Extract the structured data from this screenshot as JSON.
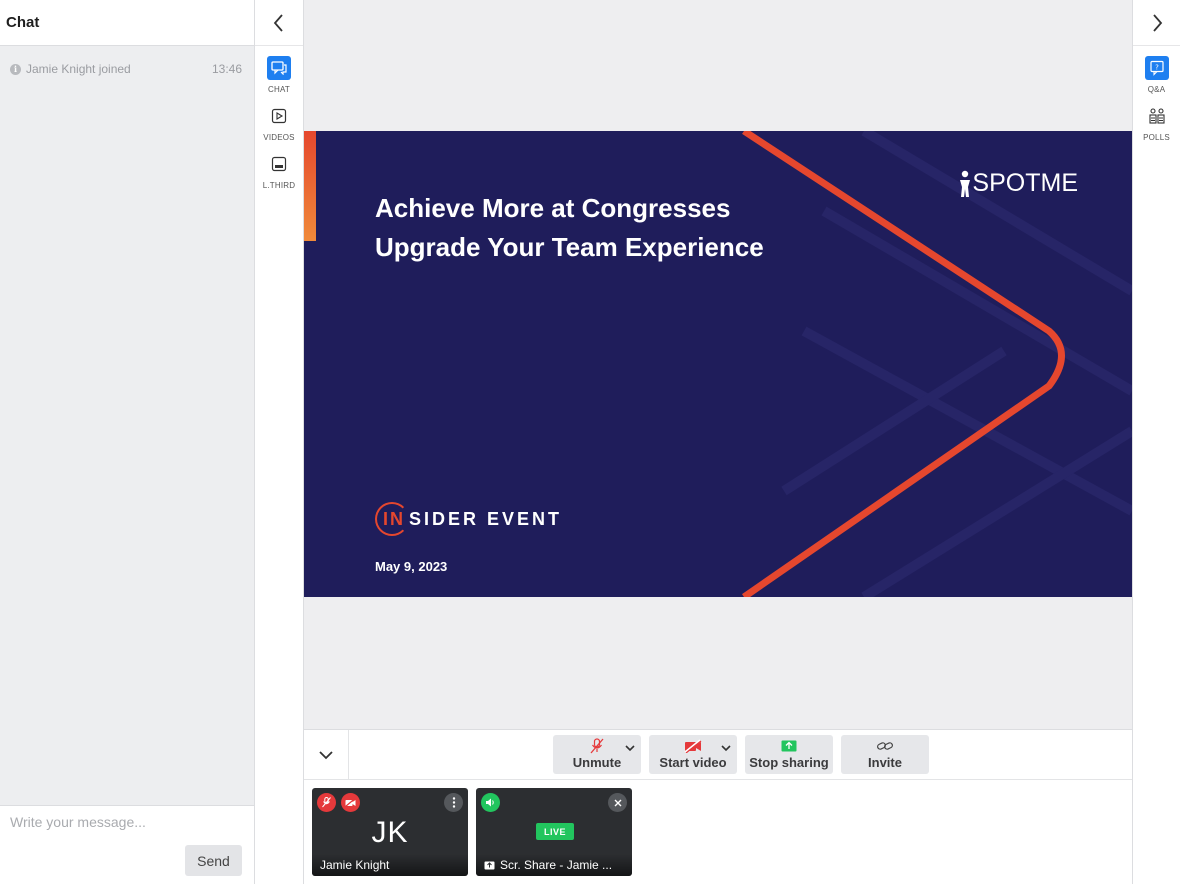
{
  "chat": {
    "title": "Chat",
    "messages": [
      {
        "icon": "info-icon",
        "text": "Jamie Knight joined",
        "time": "13:46"
      }
    ],
    "input_placeholder": "Write your message...",
    "send_label": "Send"
  },
  "left_rail": {
    "items": [
      {
        "label": "CHAT",
        "icon": "chat-icon",
        "active": true
      },
      {
        "label": "VIDEOS",
        "icon": "video-play-icon",
        "active": false
      },
      {
        "label": "L.THIRD",
        "icon": "lower-third-icon",
        "active": false
      }
    ]
  },
  "right_rail": {
    "items": [
      {
        "label": "Q&A",
        "icon": "qa-icon",
        "active": true
      },
      {
        "label": "POLLS",
        "icon": "polls-icon",
        "active": false
      }
    ]
  },
  "slide": {
    "title_line1": "Achieve More at Congresses",
    "title_line2": "Upgrade Your Team Experience",
    "logo": "SPOTME",
    "event_prefix": "IN",
    "event_rest": "SIDER EVENT",
    "date": "May 9, 2023",
    "colors": {
      "background": "#1f1d5b",
      "accent": "#e5472e"
    }
  },
  "controls": {
    "unmute": "Unmute",
    "start_video": "Start video",
    "stop_sharing": "Stop sharing",
    "invite": "Invite"
  },
  "participants": [
    {
      "initials": "JK",
      "name": "Jamie Knight",
      "muted": true,
      "video_off": true
    },
    {
      "name": "Scr. Share - Jamie ...",
      "live_label": "LIVE",
      "audio_on": true
    }
  ],
  "colors": {
    "primary": "#1e7ff0",
    "danger": "#e5393b",
    "live": "#22c55e"
  }
}
